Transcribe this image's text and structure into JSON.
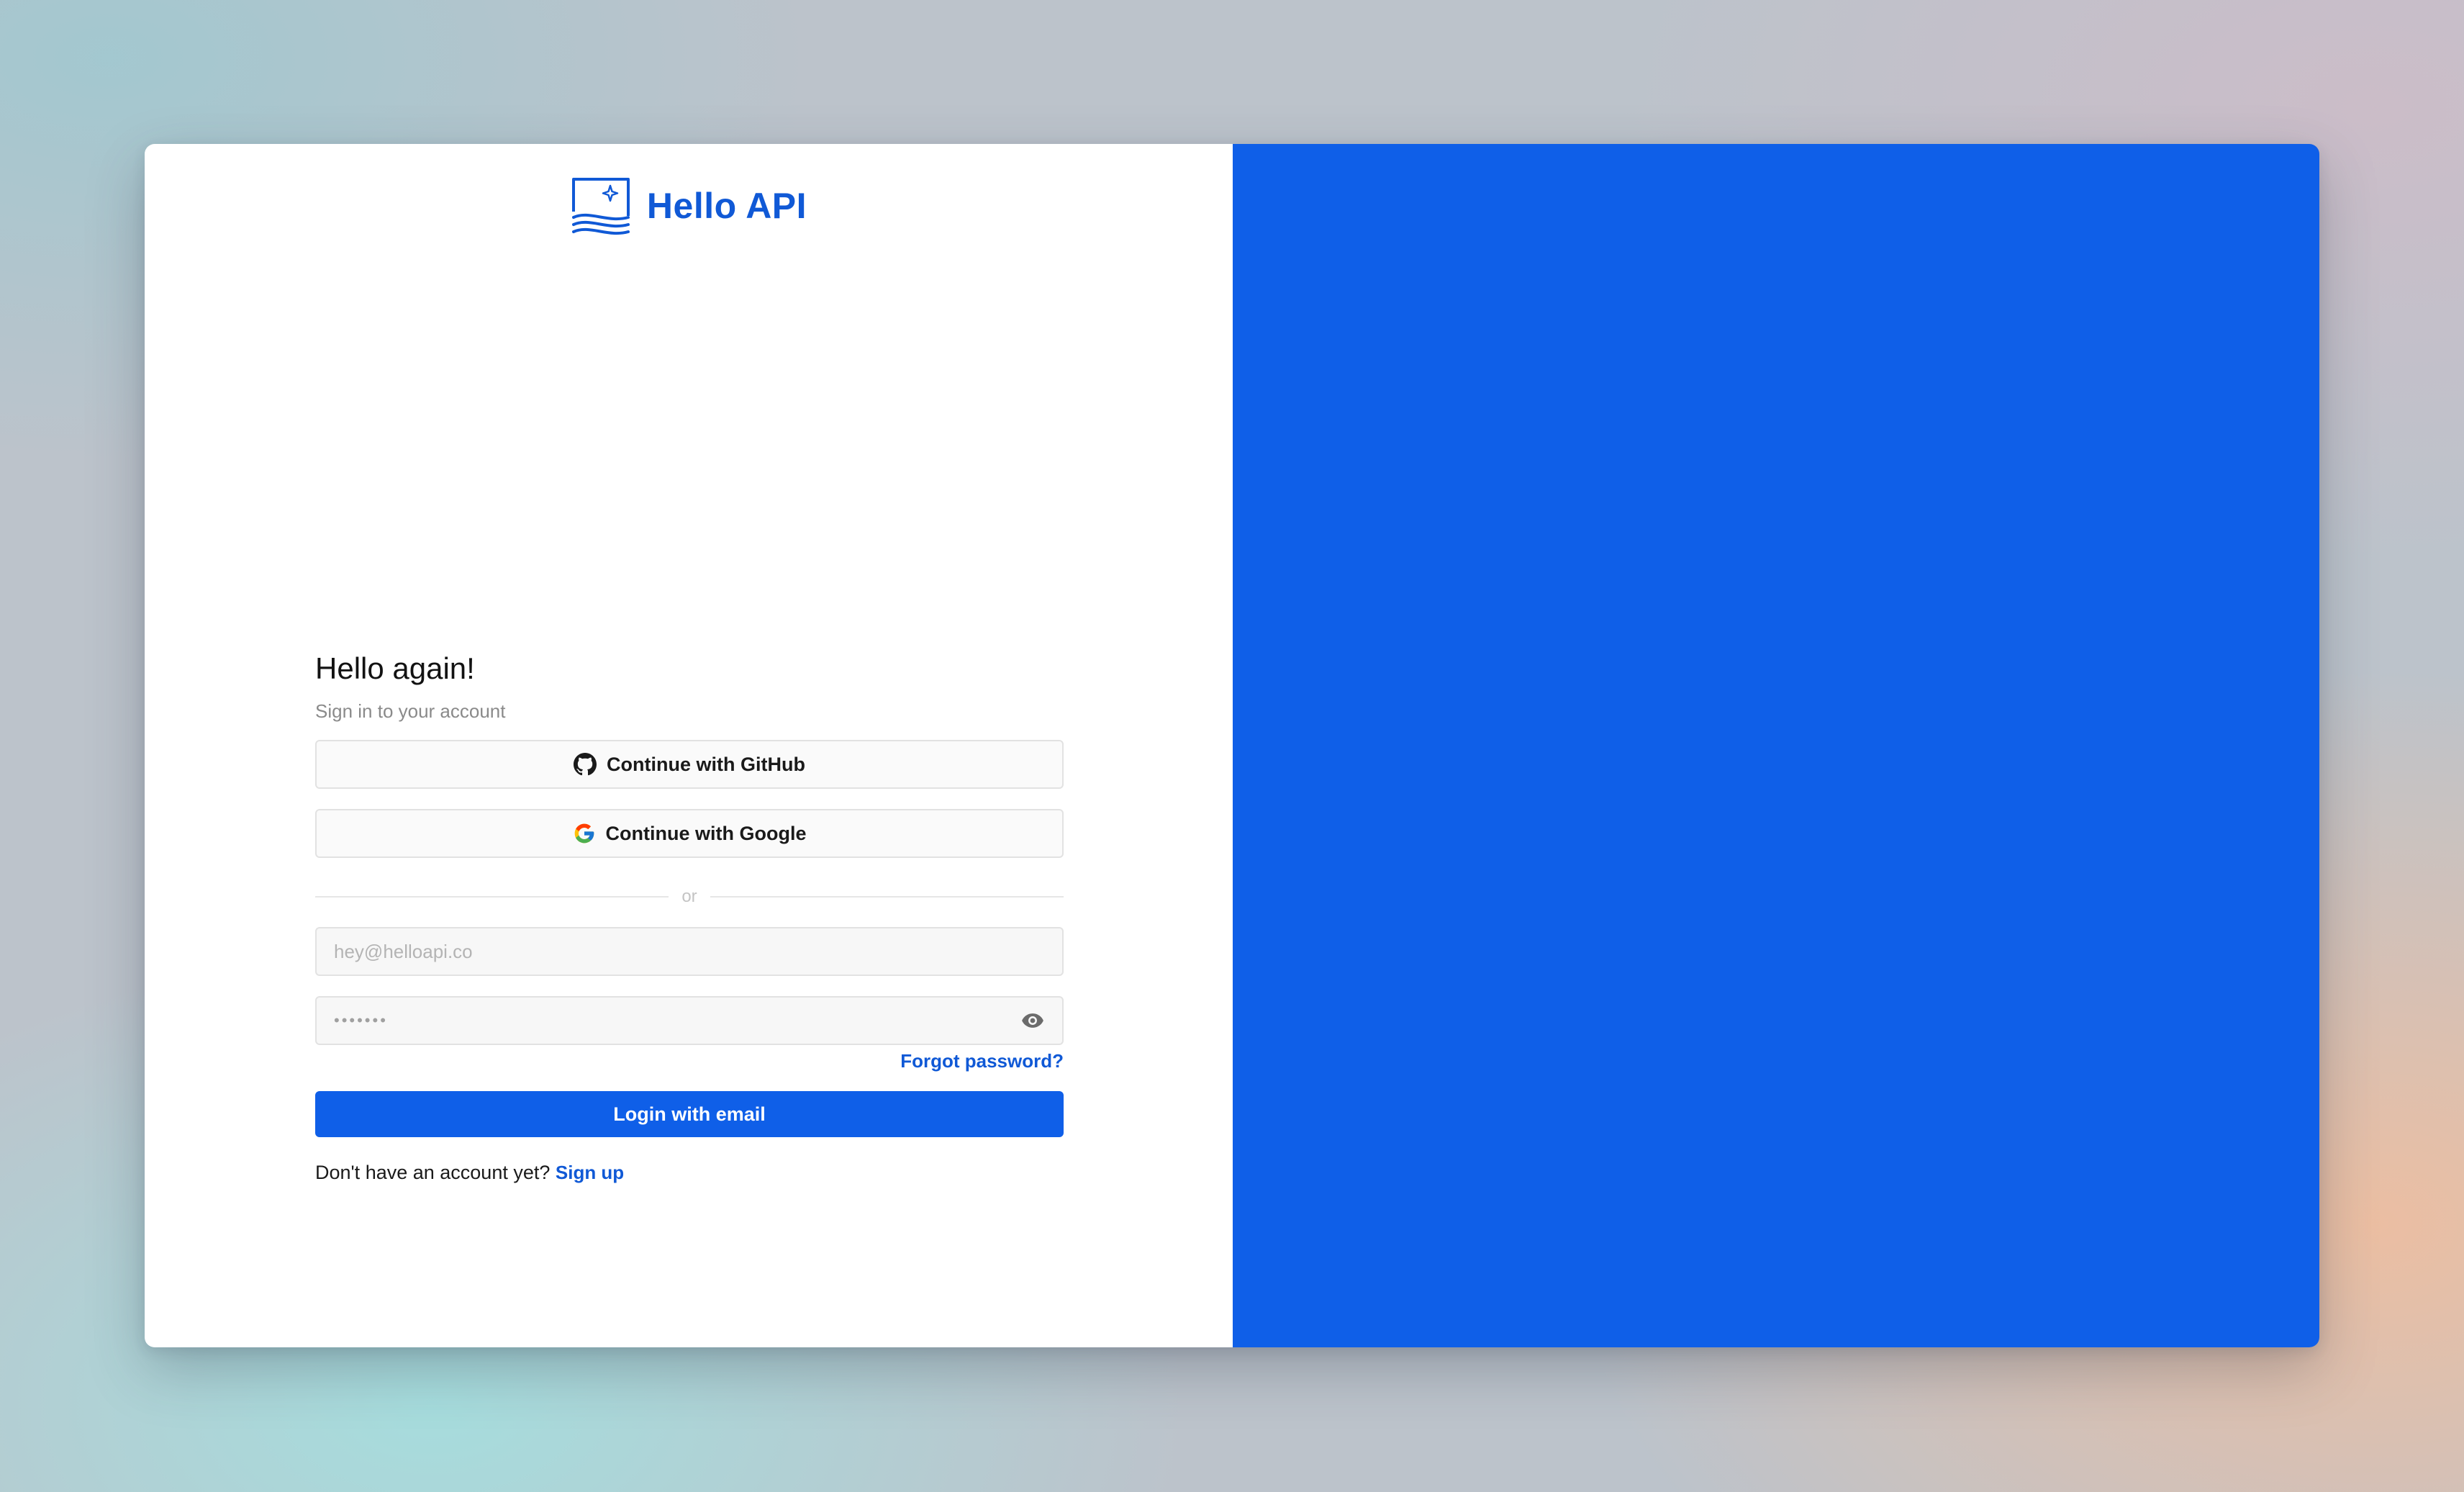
{
  "brand": {
    "name": "Hello API",
    "logo_icon": "monitor-sparkle-waves-icon",
    "color": "#1059d6"
  },
  "login": {
    "title": "Hello again!",
    "subtitle": "Sign in to your account",
    "github_button": {
      "label": "Continue with GitHub",
      "icon": "github-icon"
    },
    "google_button": {
      "label": "Continue with Google",
      "icon": "google-icon"
    },
    "divider_text": "or",
    "email": {
      "placeholder": "hey@helloapi.co",
      "value": ""
    },
    "password": {
      "masked_value": "•••••••",
      "toggle_icon": "eye-icon"
    },
    "forgot_password": "Forgot password?",
    "submit_label": "Login with email",
    "signup_prompt": "Don't have an account yet?",
    "signup_link": "Sign up"
  },
  "colors": {
    "accent": "#0f5fe8",
    "link": "#1059d6",
    "right_panel": "#0f5fe8"
  }
}
